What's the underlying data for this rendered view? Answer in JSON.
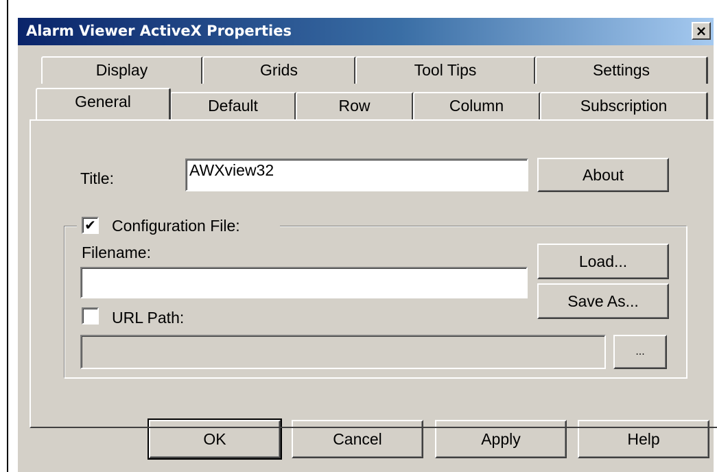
{
  "window": {
    "title": "Alarm Viewer  ActiveX Properties",
    "close_glyph": "×"
  },
  "tabs_back": [
    {
      "label": "Display"
    },
    {
      "label": "Grids"
    },
    {
      "label": "Tool Tips"
    },
    {
      "label": "Settings"
    }
  ],
  "tabs_front": [
    {
      "label": "General",
      "active": true
    },
    {
      "label": "Default"
    },
    {
      "label": "Row"
    },
    {
      "label": "Column"
    },
    {
      "label": "Subscription"
    }
  ],
  "general": {
    "title_label": "Title:",
    "title_value": "AWXview32",
    "about_button": "About",
    "config_group": {
      "label": "Configuration File:",
      "checked": true,
      "check_glyph": "✔"
    },
    "filename_label": "Filename:",
    "filename_value": "",
    "load_button": "Load...",
    "saveas_button": "Save As...",
    "url_path": {
      "label": "URL Path:",
      "checked": false
    },
    "url_value": "",
    "browse_button": "..."
  },
  "footer": {
    "ok": "OK",
    "cancel": "Cancel",
    "apply": "Apply",
    "help": "Help"
  }
}
